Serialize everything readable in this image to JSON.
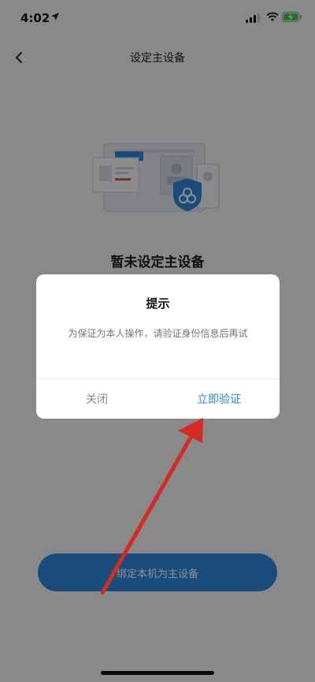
{
  "status_bar": {
    "time": "4:02"
  },
  "nav": {
    "title": "设定主设备"
  },
  "main": {
    "empty_title": "暂未设定主设备",
    "primary_button": "绑定本机为主设备"
  },
  "dialog": {
    "title": "提示",
    "message": "为保证为本人操作，请验证身份信息后再试",
    "close_label": "关闭",
    "verify_label": "立即验证"
  },
  "colors": {
    "accent": "#2b87dd",
    "button": "#2f88dc",
    "annotation_arrow": "#d32b21",
    "overlay": "rgba(0,0,0,0.44)"
  },
  "icons": [
    "location-arrow-icon",
    "signal-icon",
    "wifi-icon",
    "battery-charging-icon",
    "back-chevron-icon",
    "devices-illustration-icon"
  ]
}
